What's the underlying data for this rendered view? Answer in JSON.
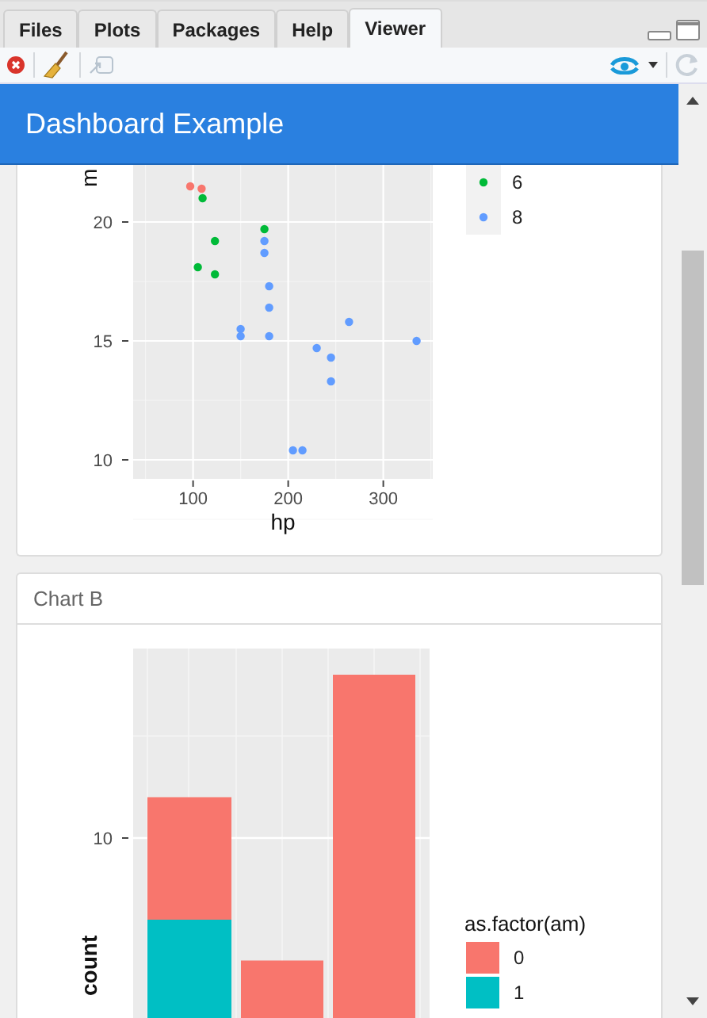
{
  "tabs": [
    {
      "label": "Files",
      "selected": false
    },
    {
      "label": "Plots",
      "selected": false
    },
    {
      "label": "Packages",
      "selected": false
    },
    {
      "label": "Help",
      "selected": false
    },
    {
      "label": "Viewer",
      "selected": true
    }
  ],
  "header": {
    "title": "Dashboard Example"
  },
  "cards": [
    {
      "kind": "scatter",
      "chart_data": {
        "type": "scatter",
        "xlabel": "hp",
        "ylabel": "m",
        "xlim": [
          37,
          352
        ],
        "ylim": [
          9.2,
          22.4
        ],
        "xticks": [
          100,
          200,
          300
        ],
        "yticks": [
          10,
          15,
          20
        ],
        "grid": true,
        "legend": "right",
        "x": [
          97,
          109,
          110,
          123,
          123,
          105,
          175,
          175,
          175,
          180,
          180,
          180,
          150,
          150,
          245,
          245,
          230,
          205,
          215,
          264,
          335
        ],
        "series": [
          {
            "color": "#f8766d",
            "values": [
              21.5,
              21.4,
              null,
              null,
              null,
              null,
              null,
              null,
              null,
              null,
              null,
              null,
              null,
              null,
              null,
              null,
              null,
              null,
              null,
              null,
              null
            ]
          },
          {
            "name": "6",
            "color": "#00ba38",
            "values": [
              null,
              null,
              21.0,
              19.2,
              17.8,
              18.1,
              19.7,
              null,
              null,
              null,
              null,
              null,
              null,
              null,
              null,
              null,
              null,
              null,
              null,
              null,
              null
            ]
          },
          {
            "name": "8",
            "color": "#619cff",
            "values": [
              null,
              null,
              null,
              null,
              null,
              null,
              null,
              18.7,
              19.2,
              16.4,
              17.3,
              15.2,
              15.5,
              15.2,
              14.3,
              13.3,
              14.7,
              10.4,
              10.4,
              15.8,
              15.0
            ]
          }
        ]
      }
    },
    {
      "kind": "bar",
      "title": "Chart B",
      "ytick": "10",
      "ylabel": "count",
      "legend": {
        "title": "as.factor(am)",
        "items": [
          {
            "label": "0",
            "color": "#f8766d"
          },
          {
            "label": "1",
            "color": "#00bfc4"
          }
        ]
      }
    }
  ]
}
